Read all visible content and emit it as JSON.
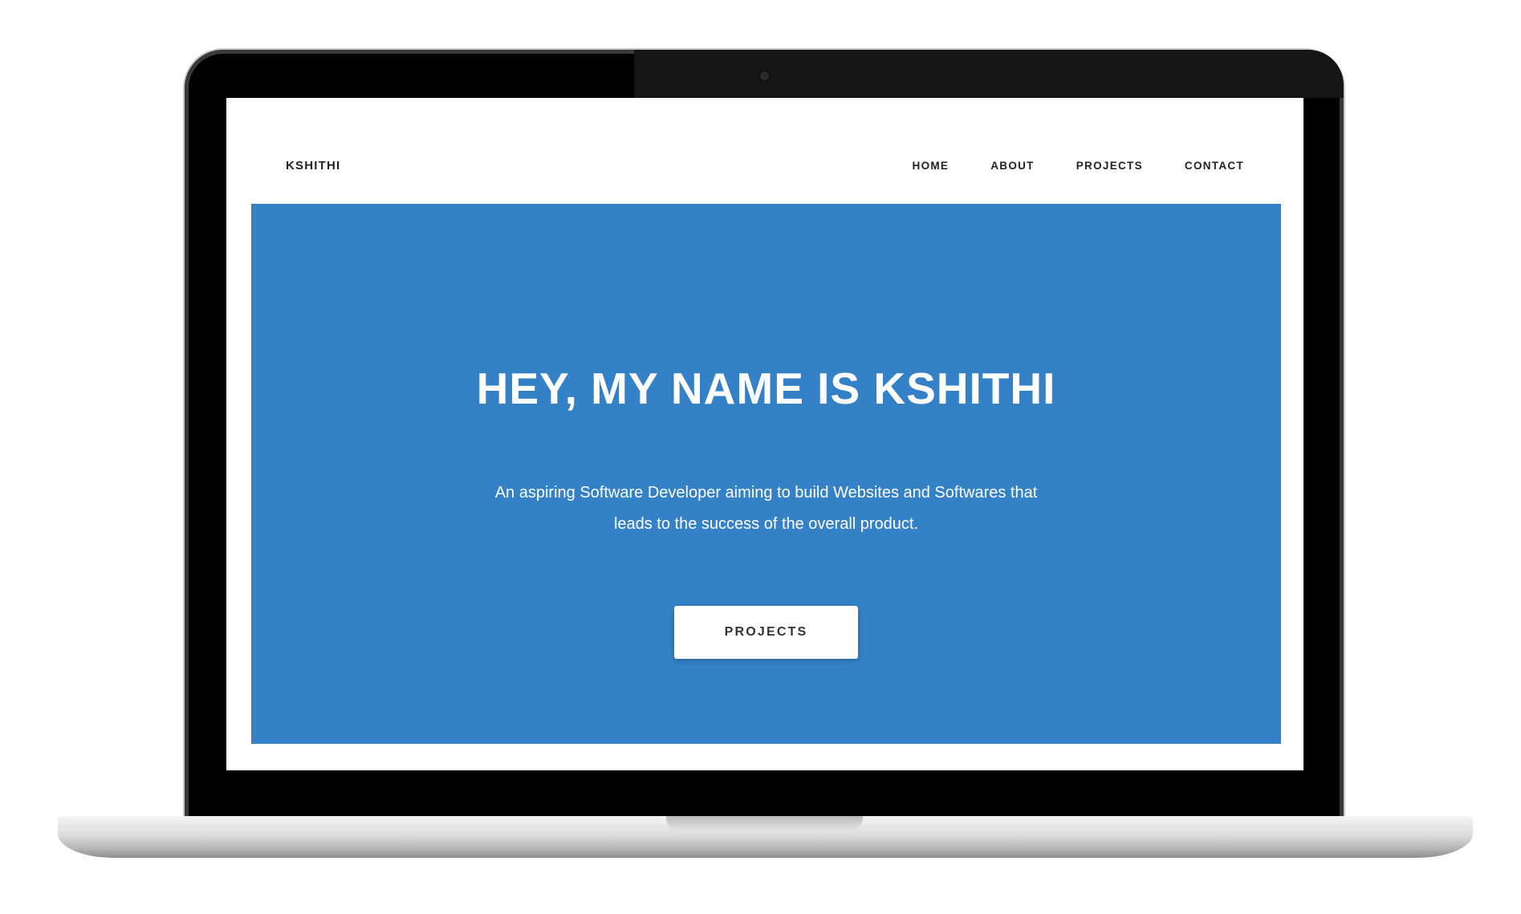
{
  "site": {
    "brand": "KSHITHI",
    "nav": [
      {
        "label": "HOME"
      },
      {
        "label": "ABOUT"
      },
      {
        "label": "PROJECTS"
      },
      {
        "label": "CONTACT"
      }
    ]
  },
  "hero": {
    "title": "HEY, MY NAME IS KSHITHI",
    "subtitle": "An aspiring Software Developer aiming to build Websites and Softwares that leads to the success of the overall product.",
    "button_label": "PROJECTS",
    "background_color": "#3481c8"
  },
  "colors": {
    "accent": "#3481c8",
    "text_dark": "#222222",
    "text_light": "#ffffff"
  }
}
